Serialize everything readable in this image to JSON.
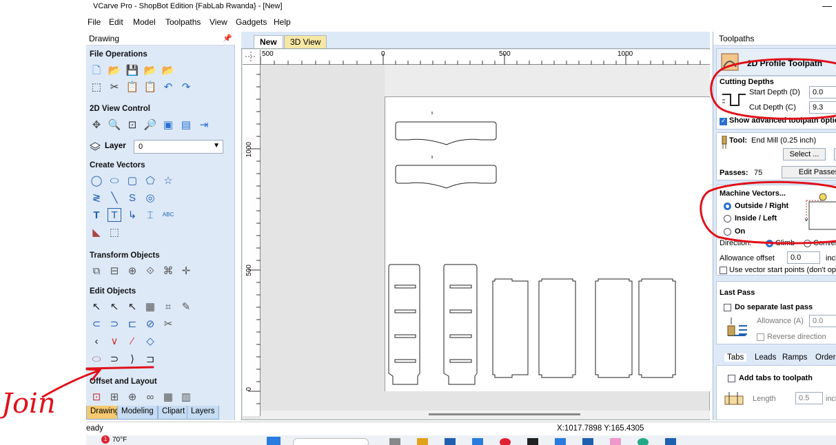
{
  "window": {
    "title": "VCarve Pro - ShopBot Edition {FabLab Rwanda} - [New]",
    "minimize_glyph": "—"
  },
  "menu": [
    "File",
    "Edit",
    "Model",
    "Toolpaths",
    "View",
    "Gadgets",
    "Help"
  ],
  "left_panel": {
    "header": "Drawing",
    "pin_glyph": "📌",
    "sections": {
      "file_operations": "File Operations",
      "view_control": "2D View Control",
      "create_vectors": "Create Vectors",
      "transform_objects": "Transform Objects",
      "edit_objects": "Edit Objects",
      "offset_layout": "Offset and Layout"
    },
    "layer": {
      "label": "Layer",
      "value": "0",
      "arrow": "▼",
      "icon": "layers-icon"
    },
    "tabs": [
      "Drawing",
      "Modeling",
      "Clipart",
      "Layers"
    ],
    "icons": {
      "file_ops": [
        "🗋",
        "📂",
        "💾",
        "📂",
        "📂",
        "⬚",
        "✂",
        "📋",
        "📋",
        "↶",
        "↷"
      ],
      "view": [
        "✥",
        "🔍",
        "⊡",
        "🔎",
        "▣",
        "▤",
        "⇥"
      ],
      "vectors_row1": [
        "◯",
        "⬭",
        "▢",
        "⬠",
        "☆"
      ],
      "vectors_row2": [
        "≷",
        "╲",
        "S",
        "◎"
      ],
      "vectors_row3": [
        "T",
        "T",
        "↳",
        "⌶",
        "ABC"
      ],
      "vectors_row4": [
        "◣",
        "⬚"
      ],
      "transform": [
        "⧉",
        "⊟",
        "⊕",
        "⟐",
        "⌘",
        "✛"
      ],
      "edit_row1": [
        "↖",
        "↖",
        "↖",
        "▦",
        "⌗",
        "✎"
      ],
      "edit_row2": [
        "⊂",
        "⊃",
        "⊏",
        "⊘",
        "✂"
      ],
      "edit_row3": [
        "‹",
        "∨",
        "∕",
        "◇"
      ],
      "edit_row4": [
        "⬭",
        "⊃",
        "⟩",
        "⊐"
      ],
      "offset": [
        "⊡",
        "⊞",
        "⊕",
        "∞",
        "▦",
        "▥"
      ]
    }
  },
  "document_tabs": [
    {
      "label": "New",
      "active": true
    },
    {
      "label": "3D View",
      "active": false
    }
  ],
  "rulers": {
    "horizontal": [
      "500",
      "0",
      "500",
      "1000"
    ],
    "vertical": [
      "1000",
      "500",
      "0"
    ]
  },
  "status": {
    "left": "eady",
    "coordinates": "X:1017.7898 Y:165.4305"
  },
  "taskbar": {
    "badge": "1",
    "weather": "70°F"
  },
  "toolpaths_panel": {
    "header": "Toolpaths",
    "tool_title": "2D Profile Toolpath",
    "cutting_depths": {
      "title": "Cutting Depths",
      "start_label": "Start Depth (D)",
      "start_value": "0.0",
      "cut_label": "Cut Depth (C)",
      "cut_value": "9.3"
    },
    "show_advanced": "Show advanced toolpath options",
    "tool": {
      "label": "Tool:",
      "value": "End Mill (0.25 inch)",
      "select_button": "Select ..."
    },
    "passes": {
      "label": "Passes:",
      "value": "75",
      "edit_button": "Edit Passes"
    },
    "machine_vectors": {
      "title": "Machine Vectors...",
      "options": [
        "Outside / Right",
        "Inside / Left",
        "On"
      ],
      "selected": "Outside / Right"
    },
    "direction": {
      "label": "Direction:",
      "options": [
        "Climb",
        "Conventional"
      ],
      "selected": "Climb"
    },
    "allowance": {
      "label": "Allowance offset",
      "value": "0.0",
      "unit": "inch"
    },
    "use_vector_start": "Use vector start points (don't optimise)",
    "last_pass": {
      "title": "Last Pass",
      "do_separate": "Do separate last pass",
      "allowance_label": "Allowance (A)",
      "allowance_value": "0.0",
      "reverse": "Reverse direction"
    },
    "bottom_tabs": [
      "Tabs",
      "Leads",
      "Ramps",
      "Order"
    ],
    "add_tabs": "Add tabs to toolpath",
    "length": {
      "label": "Length",
      "value": "0.5",
      "unit": "inch"
    }
  },
  "annotation": {
    "text": "Join",
    "color": "#e0101a"
  }
}
